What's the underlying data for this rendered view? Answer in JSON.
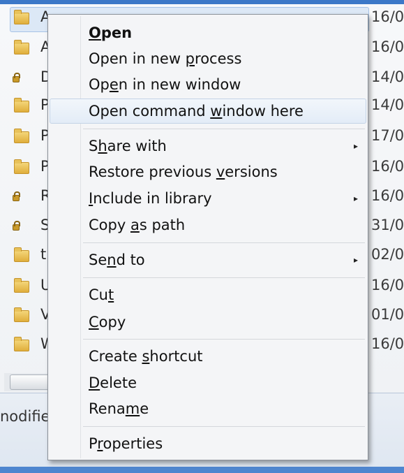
{
  "explorer": {
    "rows": [
      {
        "letter": "A",
        "date": "16/0",
        "icon": "folder"
      },
      {
        "letter": "A",
        "date": "16/0",
        "icon": "folder"
      },
      {
        "letter": "D",
        "date": "14/0",
        "icon": "locked-folder"
      },
      {
        "letter": "P",
        "date": "14/0",
        "icon": "folder"
      },
      {
        "letter": "P",
        "date": "17/0",
        "icon": "folder"
      },
      {
        "letter": "P",
        "date": "16/0",
        "icon": "folder"
      },
      {
        "letter": "R",
        "date": "16/0",
        "icon": "locked-folder"
      },
      {
        "letter": "S",
        "date": "31/0",
        "icon": "locked-folder"
      },
      {
        "letter": "t",
        "date": "02/0",
        "icon": "folder"
      },
      {
        "letter": "U",
        "date": "16/0",
        "icon": "folder"
      },
      {
        "letter": "V",
        "date": "01/0",
        "icon": "folder"
      },
      {
        "letter": "W",
        "date": "16/0",
        "icon": "folder"
      }
    ],
    "details_text": "nodifie"
  },
  "menu": {
    "open": {
      "pre": "",
      "key": "O",
      "post": "pen"
    },
    "open_new_process": {
      "pre": "Open in new ",
      "key": "p",
      "post": "rocess"
    },
    "open_new_window": {
      "pre": "Op",
      "key": "e",
      "post": "n in new window"
    },
    "open_command_window": {
      "pre": "Open command ",
      "key": "w",
      "post": "indow here"
    },
    "share_with": {
      "pre": "S",
      "key": "h",
      "post": "are with"
    },
    "restore_previous": {
      "pre": "Restore previous ",
      "key": "v",
      "post": "ersions"
    },
    "include_in_library": {
      "pre": "",
      "key": "I",
      "post": "nclude in library"
    },
    "copy_as_path": {
      "pre": "Copy ",
      "key": "a",
      "post": "s path"
    },
    "send_to": {
      "pre": "Se",
      "key": "n",
      "post": "d to"
    },
    "cut": {
      "pre": "Cu",
      "key": "t",
      "post": ""
    },
    "copy": {
      "pre": "",
      "key": "C",
      "post": "opy"
    },
    "create_shortcut": {
      "pre": "Create ",
      "key": "s",
      "post": "hortcut"
    },
    "delete": {
      "pre": "",
      "key": "D",
      "post": "elete"
    },
    "rename": {
      "pre": "Rena",
      "key": "m",
      "post": "e"
    },
    "properties": {
      "pre": "P",
      "key": "r",
      "post": "operties"
    },
    "submenu_arrow": "▸"
  }
}
